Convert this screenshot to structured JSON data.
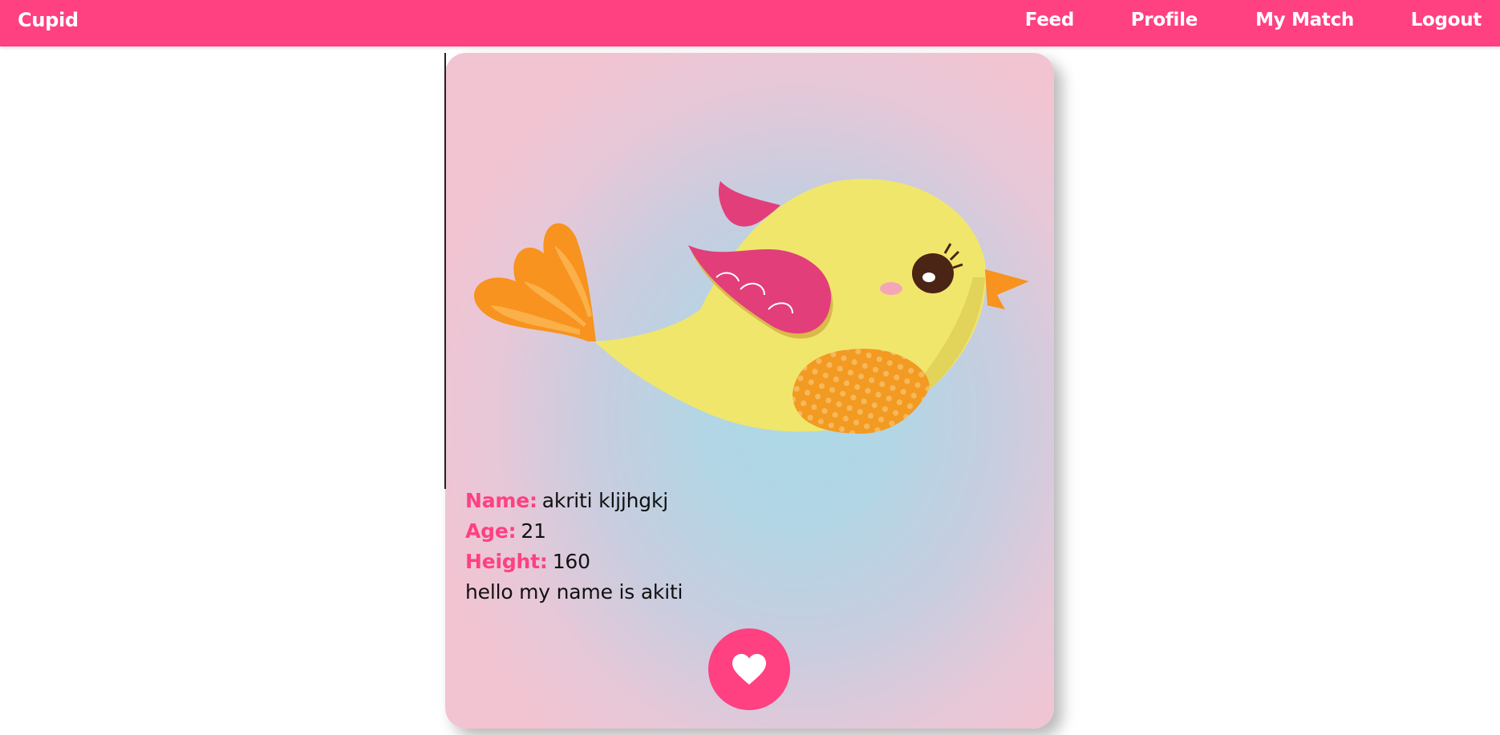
{
  "navbar": {
    "brand": "Cupid",
    "links": [
      {
        "label": "Feed"
      },
      {
        "label": "Profile"
      },
      {
        "label": "My Match"
      },
      {
        "label": "Logout"
      }
    ],
    "color": "#ff4081"
  },
  "profile": {
    "fields": [
      {
        "label": "Name:",
        "value": "akriti kljjhgkj"
      },
      {
        "label": "Age:",
        "value": "21"
      },
      {
        "label": "Height:",
        "value": "160"
      }
    ],
    "bio": "hello my name is akiti"
  },
  "actions": {
    "like_icon": "heart-icon"
  },
  "colors": {
    "accent": "#ff4081",
    "card_center": "#add8e6",
    "card_edge": "#f2c4d2"
  }
}
